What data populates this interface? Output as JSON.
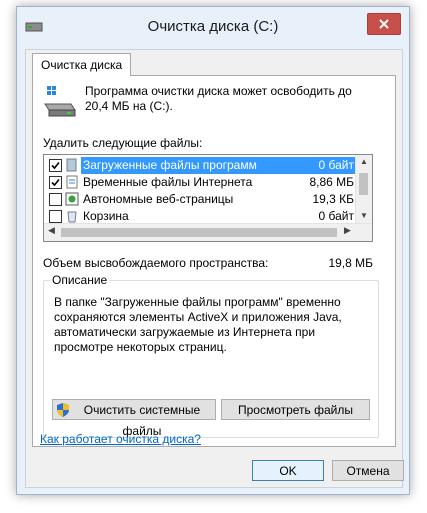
{
  "window": {
    "title": "Очистка диска  (C:)",
    "tab_label": "Очистка диска"
  },
  "intro_text": "Программа очистки диска может освободить до 20,4 МБ на  (C:).",
  "files": {
    "label": "Удалить следующие файлы:",
    "items": [
      {
        "checked": true,
        "name": "Загруженные файлы программ",
        "size": "0 байт",
        "selected": true,
        "icon": "folder-icon"
      },
      {
        "checked": true,
        "name": "Временные файлы Интернета",
        "size": "8,86 МБ",
        "selected": false,
        "icon": "internet-file-icon"
      },
      {
        "checked": false,
        "name": "Автономные веб-страницы",
        "size": "19,3 КБ",
        "selected": false,
        "icon": "offline-page-icon"
      },
      {
        "checked": false,
        "name": "Корзина",
        "size": "0 байт",
        "selected": false,
        "icon": "recycle-bin-icon"
      }
    ]
  },
  "space": {
    "label": "Объем высвобождаемого пространства:",
    "value": "19,8 МБ"
  },
  "description": {
    "title": "Описание",
    "text": "В папке \"Загруженные файлы программ\" временно сохраняются элементы ActiveX и приложения Java, автоматически загружаемые из Интернета при просмотре некоторых страниц."
  },
  "buttons": {
    "clean_system": "Очистить системные файлы",
    "view_files": "Просмотреть файлы",
    "ok": "OK",
    "cancel": "Отмена"
  },
  "help_link": "Как работает очистка диска?",
  "colors": {
    "selection": "#3399ff",
    "close_button": "#c7504a",
    "link": "#0066cc"
  }
}
